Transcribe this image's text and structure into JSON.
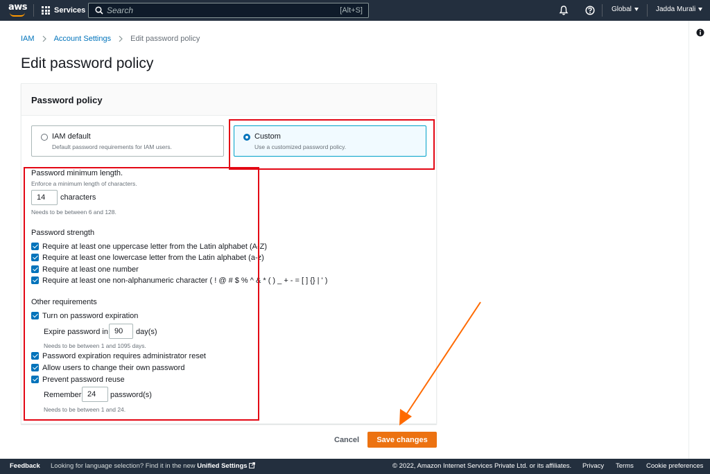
{
  "topnav": {
    "logo_text": "aws",
    "services_label": "Services",
    "search_placeholder": "Search",
    "search_shortcut": "[Alt+S]",
    "region_label": "Global",
    "user_label": "Jadda Murali",
    "icons": [
      "grid-icon",
      "search-icon",
      "bell-icon",
      "help-icon",
      "caret-down-icon"
    ]
  },
  "breadcrumb": {
    "items": [
      "IAM",
      "Account Settings",
      "Edit password policy"
    ]
  },
  "page_title": "Edit password policy",
  "panel": {
    "title": "Password policy",
    "tiles": [
      {
        "label": "IAM default",
        "description": "Default password requirements for IAM users.",
        "selected": false
      },
      {
        "label": "Custom",
        "description": "Use a customized password policy.",
        "selected": true
      }
    ],
    "min_length": {
      "heading": "Password minimum length.",
      "description": "Enforce a minimum length of characters.",
      "value": "14",
      "unit": "characters",
      "hint": "Needs to be between 6 and 128."
    },
    "strength": {
      "heading": "Password strength",
      "options": [
        {
          "label": "Require at least one uppercase letter from the Latin alphabet (A-Z)",
          "checked": true
        },
        {
          "label": "Require at least one lowercase letter from the Latin alphabet (a-z)",
          "checked": true
        },
        {
          "label": "Require at least one number",
          "checked": true
        },
        {
          "label": "Require at least one non-alphanumeric character ( ! @ # $ % ^ & * ( ) _ + - = [ ] {} | ' )",
          "checked": true
        }
      ]
    },
    "other": {
      "heading": "Other requirements",
      "expiration": {
        "label": "Turn on password expiration",
        "checked": true
      },
      "expire_prefix": "Expire password in",
      "expire_value": "90",
      "expire_unit": "day(s)",
      "expire_hint": "Needs to be between 1 and 1095 days.",
      "options": [
        {
          "label": "Password expiration requires administrator reset",
          "checked": true
        },
        {
          "label": "Allow users to change their own password",
          "checked": true
        },
        {
          "label": "Prevent password reuse",
          "checked": true
        }
      ],
      "remember_prefix": "Remember",
      "remember_value": "24",
      "remember_unit": "password(s)",
      "remember_hint": "Needs to be between 1 and 24."
    }
  },
  "actions": {
    "cancel_label": "Cancel",
    "save_label": "Save changes"
  },
  "footer": {
    "feedback": "Feedback",
    "language_text": "Looking for language selection? Find it in the new",
    "unified_settings": "Unified Settings",
    "copyright": "© 2022, Amazon Internet Services Private Ltd. or its affiliates.",
    "privacy": "Privacy",
    "terms": "Terms",
    "cookie": "Cookie preferences"
  },
  "colors": {
    "nav_bg": "#232f3e",
    "link": "#0073bb",
    "primary_button": "#ec7211",
    "annotation_red": "#e30613",
    "annotation_arrow": "#ff6a00",
    "selected_tile_border": "#00a1c9"
  }
}
